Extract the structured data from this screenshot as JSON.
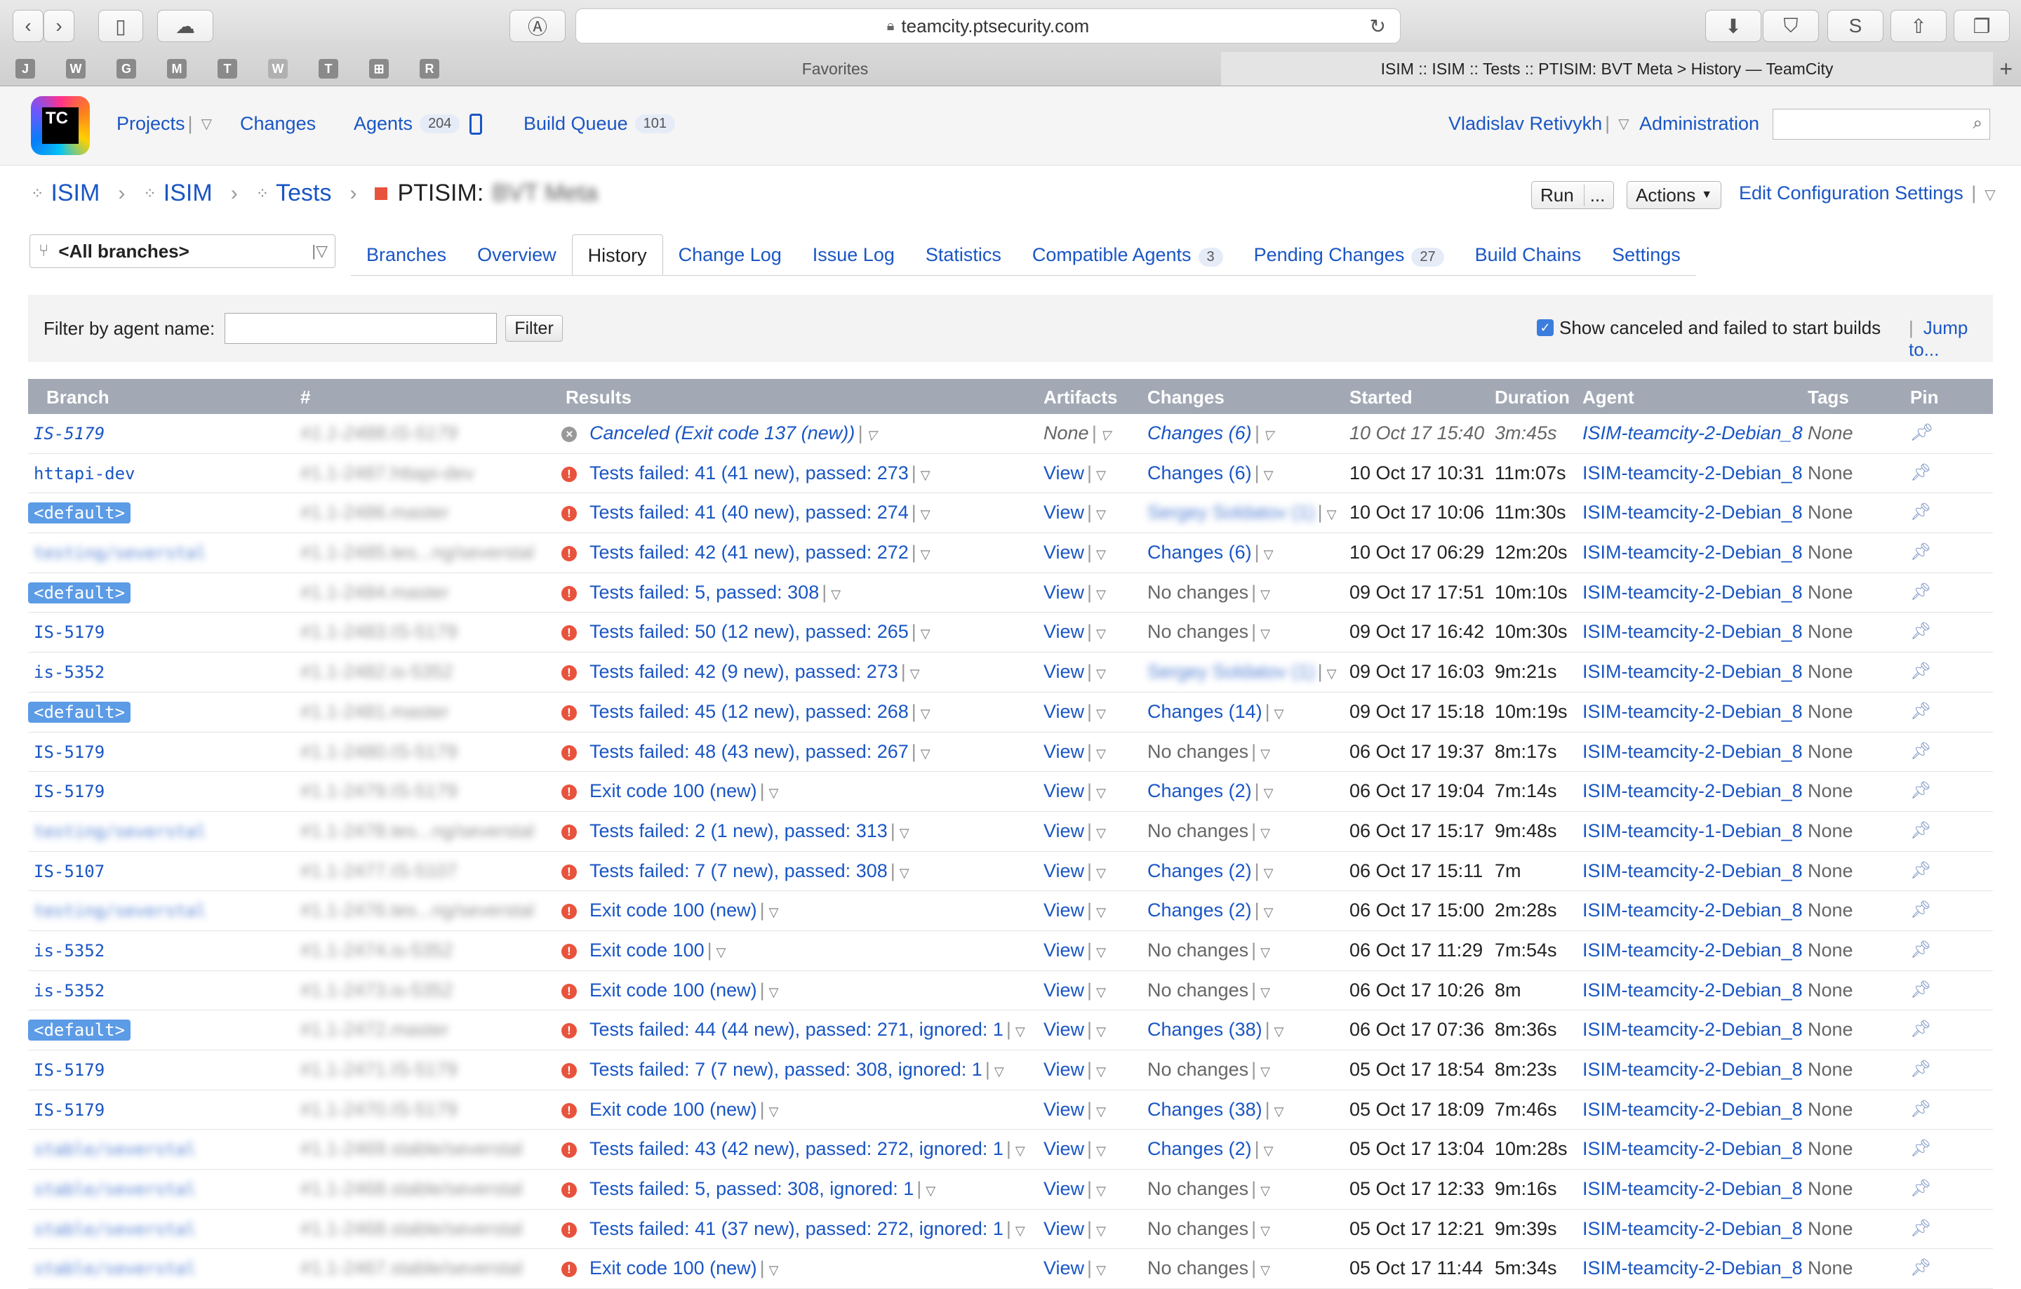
{
  "browser": {
    "url": "teamcity.ptsecurity.com",
    "favorites_label": "Favorites",
    "active_tab_title": "ISIM :: ISIM :: Tests :: PTISIM: BVT Meta > History — TeamCity",
    "fav_icons": [
      "J",
      "W",
      "G",
      "M",
      "T",
      "W",
      "T",
      "⊞",
      "R"
    ]
  },
  "header": {
    "logo_text": "TC",
    "nav": {
      "projects": "Projects",
      "changes": "Changes",
      "agents": "Agents",
      "agents_count": "204",
      "build_queue": "Build Queue",
      "build_queue_count": "101"
    },
    "user": "Vladislav Retivykh",
    "administration": "Administration"
  },
  "breadcrumb": {
    "items": [
      "ISIM",
      "ISIM",
      "Tests"
    ],
    "current_prefix": "PTISIM:",
    "current_blurred": "BVT Meta"
  },
  "actions": {
    "run": "Run",
    "run_more": "...",
    "actions": "Actions",
    "edit_config": "Edit Configuration Settings"
  },
  "branch_selector": "<All branches>",
  "tabs": [
    {
      "label": "Branches"
    },
    {
      "label": "Overview"
    },
    {
      "label": "History",
      "active": true
    },
    {
      "label": "Change Log"
    },
    {
      "label": "Issue Log"
    },
    {
      "label": "Statistics"
    },
    {
      "label": "Compatible Agents",
      "count": "3"
    },
    {
      "label": "Pending Changes",
      "count": "27"
    },
    {
      "label": "Build Chains"
    },
    {
      "label": "Settings"
    }
  ],
  "filter": {
    "label": "Filter by agent name:",
    "value": "",
    "button": "Filter",
    "show_canceled_label": "Show canceled and failed to start builds",
    "show_canceled_checked": true,
    "jump_to": "Jump to..."
  },
  "table": {
    "columns": [
      "Branch",
      "#",
      "Results",
      "Artifacts",
      "Changes",
      "Started",
      "Duration",
      "Agent",
      "Tags",
      "Pin"
    ],
    "rows": [
      {
        "branch": "IS-5179",
        "branch_style": "plain",
        "branch_blur": false,
        "num": "#1.1-2488.IS-5179",
        "status": "cancel",
        "result": "Canceled (Exit code 137 (new))",
        "artifacts": "None",
        "changes": "Changes (6)",
        "changes_link": true,
        "started": "10 Oct 17 15:40",
        "duration": "3m:45s",
        "agent": "ISIM-teamcity-2-Debian_8",
        "tags": "None",
        "italic": true
      },
      {
        "branch": "httapi-dev",
        "branch_style": "plain",
        "branch_blur": false,
        "num": "#1.1-2487.httapi-dev",
        "status": "fail",
        "result": "Tests failed: 41 (41 new), passed: 273",
        "artifacts": "View",
        "changes": "Changes (6)",
        "changes_link": true,
        "started": "10 Oct 17 10:31",
        "duration": "11m:07s",
        "agent": "ISIM-teamcity-2-Debian_8",
        "tags": "None"
      },
      {
        "branch": "<default>",
        "branch_style": "default",
        "branch_blur": false,
        "num": "#1.1-2486.master",
        "status": "fail",
        "result": "Tests failed: 41 (40 new), passed: 274",
        "artifacts": "View",
        "changes": "Sergey Soldatov (1)",
        "changes_link": true,
        "changes_blur": true,
        "started": "10 Oct 17 10:06",
        "duration": "11m:30s",
        "agent": "ISIM-teamcity-2-Debian_8",
        "tags": "None"
      },
      {
        "branch": "testing/severstal",
        "branch_style": "plain",
        "branch_blur": true,
        "num": "#1.1-2485.tes...ng/severstal",
        "status": "fail",
        "result": "Tests failed: 42 (41 new), passed: 272",
        "artifacts": "View",
        "changes": "Changes (6)",
        "changes_link": true,
        "started": "10 Oct 17 06:29",
        "duration": "12m:20s",
        "agent": "ISIM-teamcity-2-Debian_8",
        "tags": "None"
      },
      {
        "branch": "<default>",
        "branch_style": "default",
        "branch_blur": false,
        "num": "#1.1-2484.master",
        "status": "fail",
        "result": "Tests failed: 5, passed: 308",
        "artifacts": "View",
        "changes": "No changes",
        "changes_link": false,
        "started": "09 Oct 17 17:51",
        "duration": "10m:10s",
        "agent": "ISIM-teamcity-2-Debian_8",
        "tags": "None"
      },
      {
        "branch": "IS-5179",
        "branch_style": "plain",
        "branch_blur": false,
        "num": "#1.1-2483.IS-5179",
        "status": "fail",
        "result": "Tests failed: 50 (12 new), passed: 265",
        "artifacts": "View",
        "changes": "No changes",
        "changes_link": false,
        "started": "09 Oct 17 16:42",
        "duration": "10m:30s",
        "agent": "ISIM-teamcity-2-Debian_8",
        "tags": "None"
      },
      {
        "branch": "is-5352",
        "branch_style": "plain",
        "branch_blur": false,
        "num": "#1.1-2482.is-5352",
        "status": "fail",
        "result": "Tests failed: 42 (9 new), passed: 273",
        "artifacts": "View",
        "changes": "Sergey Soldatov (1)",
        "changes_link": true,
        "changes_blur": true,
        "started": "09 Oct 17 16:03",
        "duration": "9m:21s",
        "agent": "ISIM-teamcity-2-Debian_8",
        "tags": "None"
      },
      {
        "branch": "<default>",
        "branch_style": "default",
        "branch_blur": false,
        "num": "#1.1-2481.master",
        "status": "fail",
        "result": "Tests failed: 45 (12 new), passed: 268",
        "artifacts": "View",
        "changes": "Changes (14)",
        "changes_link": true,
        "started": "09 Oct 17 15:18",
        "duration": "10m:19s",
        "agent": "ISIM-teamcity-2-Debian_8",
        "tags": "None"
      },
      {
        "branch": "IS-5179",
        "branch_style": "plain",
        "branch_blur": false,
        "num": "#1.1-2480.IS-5179",
        "status": "fail",
        "result": "Tests failed: 48 (43 new), passed: 267",
        "artifacts": "View",
        "changes": "No changes",
        "changes_link": false,
        "started": "06 Oct 17 19:37",
        "duration": "8m:17s",
        "agent": "ISIM-teamcity-2-Debian_8",
        "tags": "None"
      },
      {
        "branch": "IS-5179",
        "branch_style": "plain",
        "branch_blur": false,
        "num": "#1.1-2479.IS-5179",
        "status": "fail",
        "result": "Exit code 100 (new)",
        "artifacts": "View",
        "changes": "Changes (2)",
        "changes_link": true,
        "started": "06 Oct 17 19:04",
        "duration": "7m:14s",
        "agent": "ISIM-teamcity-2-Debian_8",
        "tags": "None"
      },
      {
        "branch": "testing/severstal",
        "branch_style": "plain",
        "branch_blur": true,
        "num": "#1.1-2478.tes...ng/severstal",
        "status": "fail",
        "result": "Tests failed: 2 (1 new), passed: 313",
        "artifacts": "View",
        "changes": "No changes",
        "changes_link": false,
        "started": "06 Oct 17 15:17",
        "duration": "9m:48s",
        "agent": "ISIM-teamcity-1-Debian_8",
        "tags": "None"
      },
      {
        "branch": "IS-5107",
        "branch_style": "plain",
        "branch_blur": false,
        "num": "#1.1-2477.IS-5107",
        "status": "fail",
        "result": "Tests failed: 7 (7 new), passed: 308",
        "artifacts": "View",
        "changes": "Changes (2)",
        "changes_link": true,
        "started": "06 Oct 17 15:11",
        "duration": "7m",
        "agent": "ISIM-teamcity-2-Debian_8",
        "tags": "None"
      },
      {
        "branch": "testing/severstal",
        "branch_style": "plain",
        "branch_blur": true,
        "num": "#1.1-2476.tes...ng/severstal",
        "status": "fail",
        "result": "Exit code 100 (new)",
        "artifacts": "View",
        "changes": "Changes (2)",
        "changes_link": true,
        "started": "06 Oct 17 15:00",
        "duration": "2m:28s",
        "agent": "ISIM-teamcity-2-Debian_8",
        "tags": "None"
      },
      {
        "branch": "is-5352",
        "branch_style": "plain",
        "branch_blur": false,
        "num": "#1.1-2474.is-5352",
        "status": "fail",
        "result": "Exit code 100",
        "artifacts": "View",
        "changes": "No changes",
        "changes_link": false,
        "started": "06 Oct 17 11:29",
        "duration": "7m:54s",
        "agent": "ISIM-teamcity-2-Debian_8",
        "tags": "None"
      },
      {
        "branch": "is-5352",
        "branch_style": "plain",
        "branch_blur": false,
        "num": "#1.1-2473.is-5352",
        "status": "fail",
        "result": "Exit code 100 (new)",
        "artifacts": "View",
        "changes": "No changes",
        "changes_link": false,
        "started": "06 Oct 17 10:26",
        "duration": "8m",
        "agent": "ISIM-teamcity-2-Debian_8",
        "tags": "None"
      },
      {
        "branch": "<default>",
        "branch_style": "default",
        "branch_blur": false,
        "num": "#1.1-2472.master",
        "status": "fail",
        "result": "Tests failed: 44 (44 new), passed: 271, ignored: 1",
        "artifacts": "View",
        "changes": "Changes (38)",
        "changes_link": true,
        "started": "06 Oct 17 07:36",
        "duration": "8m:36s",
        "agent": "ISIM-teamcity-2-Debian_8",
        "tags": "None"
      },
      {
        "branch": "IS-5179",
        "branch_style": "plain",
        "branch_blur": false,
        "num": "#1.1-2471.IS-5179",
        "status": "fail",
        "result": "Tests failed: 7 (7 new), passed: 308, ignored: 1",
        "artifacts": "View",
        "changes": "No changes",
        "changes_link": false,
        "started": "05 Oct 17 18:54",
        "duration": "8m:23s",
        "agent": "ISIM-teamcity-2-Debian_8",
        "tags": "None"
      },
      {
        "branch": "IS-5179",
        "branch_style": "plain",
        "branch_blur": false,
        "num": "#1.1-2470.IS-5179",
        "status": "fail",
        "result": "Exit code 100 (new)",
        "artifacts": "View",
        "changes": "Changes (38)",
        "changes_link": true,
        "started": "05 Oct 17 18:09",
        "duration": "7m:46s",
        "agent": "ISIM-teamcity-2-Debian_8",
        "tags": "None"
      },
      {
        "branch": "stable/severstal",
        "branch_style": "plain",
        "branch_blur": true,
        "num": "#1.1-2469.stable/severstal",
        "status": "fail",
        "result": "Tests failed: 43 (42 new), passed: 272, ignored: 1",
        "artifacts": "View",
        "changes": "Changes (2)",
        "changes_link": true,
        "started": "05 Oct 17 13:04",
        "duration": "10m:28s",
        "agent": "ISIM-teamcity-2-Debian_8",
        "tags": "None"
      },
      {
        "branch": "stable/severstal",
        "branch_style": "plain",
        "branch_blur": true,
        "num": "#1.1-2468.stable/severstal",
        "status": "fail",
        "result": "Tests failed: 5, passed: 308, ignored: 1",
        "artifacts": "View",
        "changes": "No changes",
        "changes_link": false,
        "started": "05 Oct 17 12:33",
        "duration": "9m:16s",
        "agent": "ISIM-teamcity-2-Debian_8",
        "tags": "None"
      },
      {
        "branch": "stable/severstal",
        "branch_style": "plain",
        "branch_blur": true,
        "num": "#1.1-2468.stable/severstal",
        "status": "fail",
        "result": "Tests failed: 41 (37 new), passed: 272, ignored: 1",
        "artifacts": "View",
        "changes": "No changes",
        "changes_link": false,
        "started": "05 Oct 17 12:21",
        "duration": "9m:39s",
        "agent": "ISIM-teamcity-2-Debian_8",
        "tags": "None"
      },
      {
        "branch": "stable/severstal",
        "branch_style": "plain",
        "branch_blur": true,
        "num": "#1.1-2467.stable/severstal",
        "status": "fail",
        "result": "Exit code 100 (new)",
        "artifacts": "View",
        "changes": "No changes",
        "changes_link": false,
        "started": "05 Oct 17 11:44",
        "duration": "5m:34s",
        "agent": "ISIM-teamcity-2-Debian_8",
        "tags": "None"
      }
    ]
  }
}
